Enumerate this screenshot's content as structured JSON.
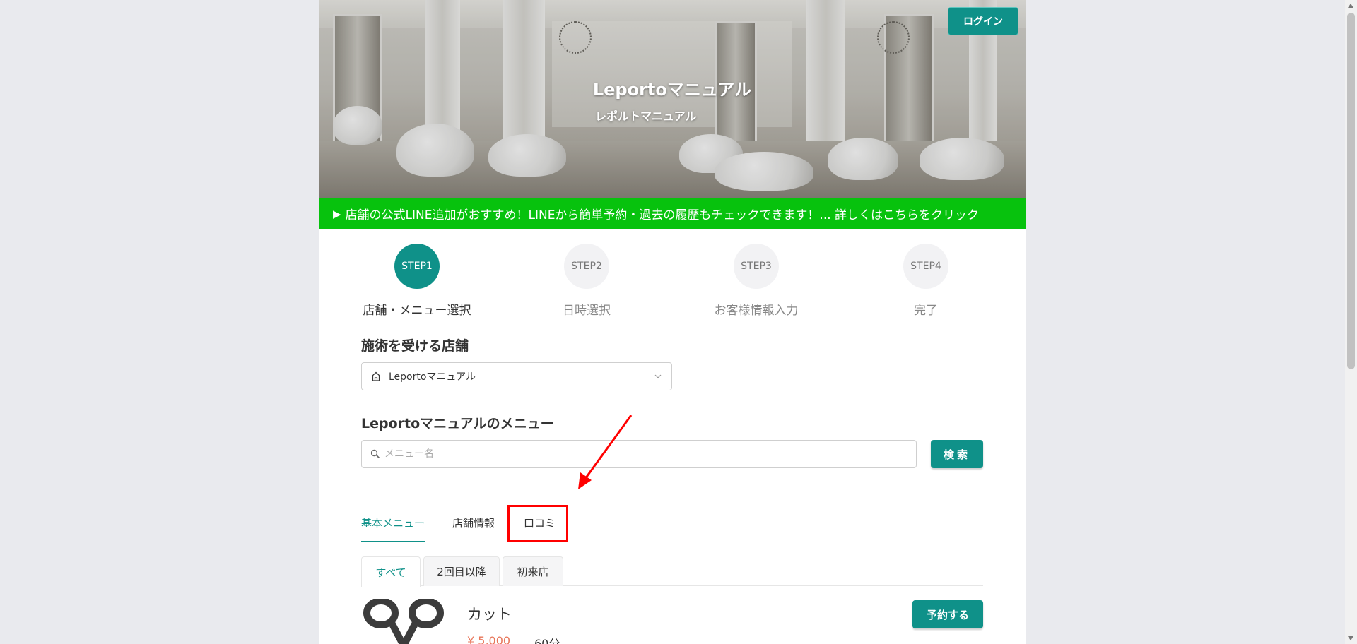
{
  "header": {
    "title": "Leportoマニュアル",
    "subtitle": "レポルトマニュアル",
    "login_label": "ログイン"
  },
  "line_banner": {
    "text": "店舗の公式LINE追加がおすすめ！LINEから簡単予約・過去の履歴もチェックできます！... 詳しくはこちらをクリック"
  },
  "steps": [
    {
      "badge": "STEP1",
      "label": "店舗・メニュー選択",
      "active": true
    },
    {
      "badge": "STEP2",
      "label": "日時選択",
      "active": false
    },
    {
      "badge": "STEP3",
      "label": "お客様情報入力",
      "active": false
    },
    {
      "badge": "STEP4",
      "label": "完了",
      "active": false
    }
  ],
  "store_section": {
    "title": "施術を受ける店舗",
    "selected_store": "Leportoマニュアル"
  },
  "menu_section": {
    "title": "Leportoマニュアルのメニュー",
    "search_placeholder": "メニュー名",
    "search_value": "",
    "search_button": "検索"
  },
  "tabs": [
    {
      "label": "基本メニュー",
      "active": true
    },
    {
      "label": "店舗情報",
      "active": false
    },
    {
      "label": "口コミ",
      "active": false
    }
  ],
  "sub_tabs": [
    {
      "label": "すべて",
      "active": true
    },
    {
      "label": "2回目以降",
      "active": false
    },
    {
      "label": "初来店",
      "active": false
    }
  ],
  "menu_items": [
    {
      "name": "カット",
      "price": "¥ 5,000",
      "duration": "60分",
      "reserve_label": "予約する"
    }
  ],
  "colors": {
    "accent": "#0f9189",
    "line_green": "#07c20d",
    "price": "#e8765a",
    "annotation_red": "#ff0000"
  }
}
